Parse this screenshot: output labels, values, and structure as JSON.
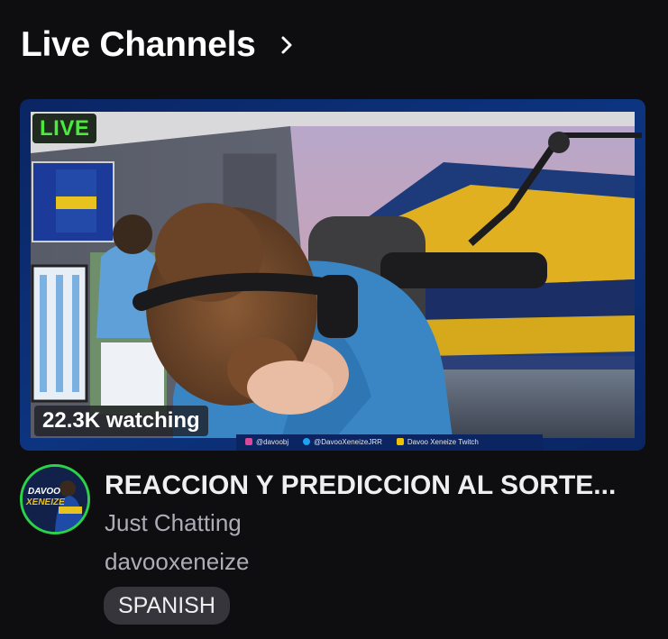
{
  "section": {
    "title": "Live Channels",
    "chevron_icon": "chevron-right-icon"
  },
  "stream": {
    "live_label": "LIVE",
    "viewers": "22.3K watching",
    "overlay": {
      "instagram": "@davoobj",
      "twitter": "@DavooXeneizeJRR",
      "youtube": "Davoo Xeneize Twitch"
    },
    "title": "REACCION Y PREDICCION AL SORTE...",
    "category": "Just Chatting",
    "channel": "davooxeneize",
    "tags": [
      "SPANISH"
    ],
    "avatar_text": {
      "line1": "DAVOO",
      "line2": "XENEIZE"
    }
  },
  "colors": {
    "background": "#0e0e10",
    "live_green": "#4aeb3a",
    "avatar_ring": "#2bd24a",
    "tag_bg": "#35353b",
    "muted_text": "#adadb8",
    "frame_blue": "#0b2a6b"
  }
}
